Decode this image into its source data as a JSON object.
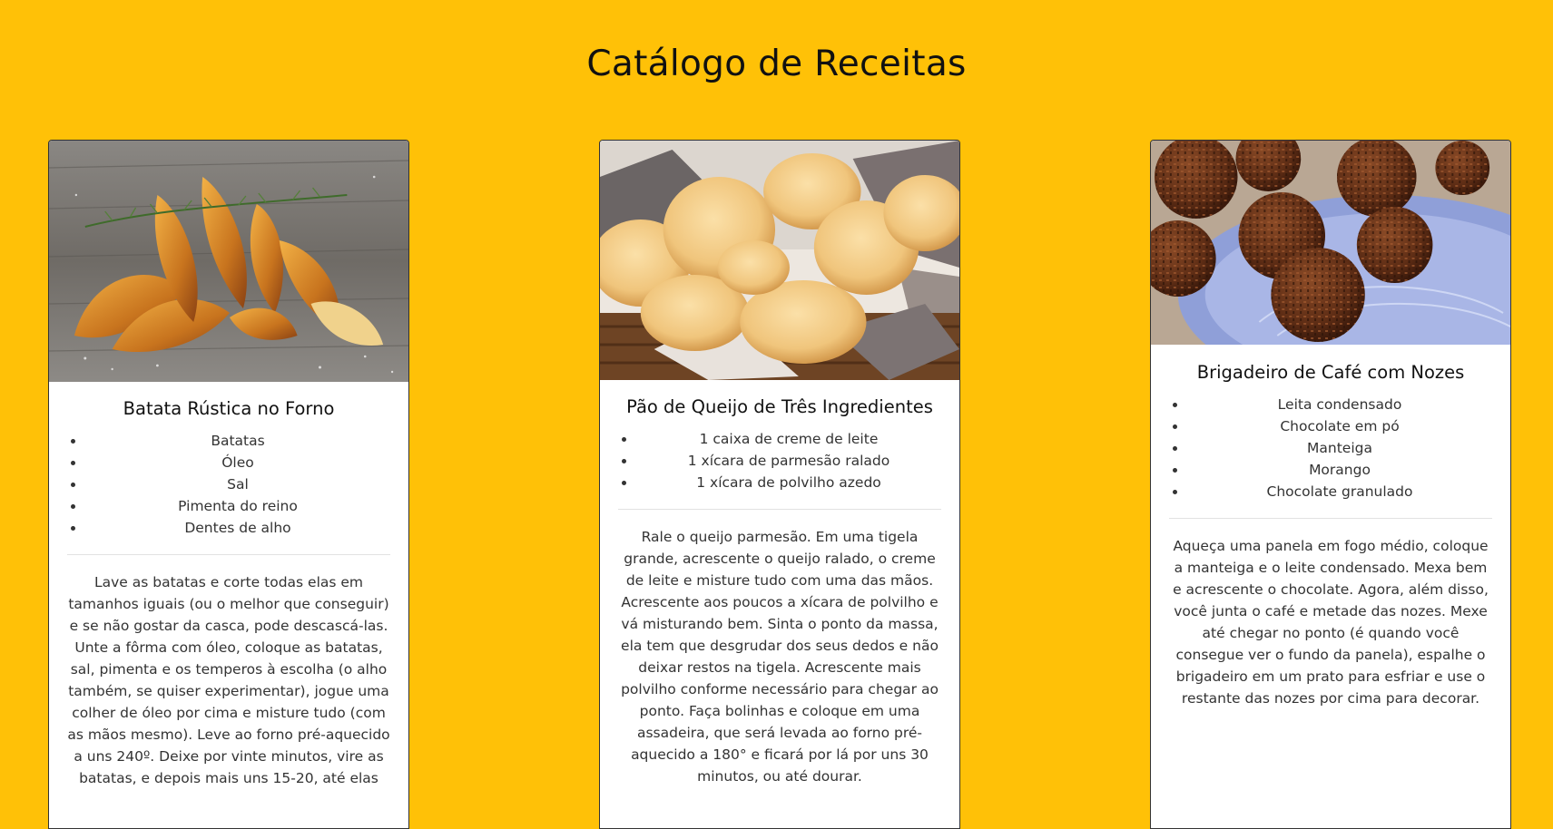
{
  "page": {
    "title": "Catálogo de Receitas",
    "background": "#FFC107"
  },
  "recipes": [
    {
      "image_icon": "potato-wedges-photo",
      "title": "Batata Rústica no Forno",
      "ingredients": [
        "Batatas",
        "Óleo",
        "Sal",
        "Pimenta do reino",
        "Dentes de alho"
      ],
      "instructions": "Lave as batatas e corte todas elas em tamanhos iguais (ou o melhor que conseguir) e se não gostar da casca, pode descascá-las. Unte a fôrma com óleo, coloque as batatas, sal, pimenta e os temperos à escolha (o alho também, se quiser experimentar), jogue uma colher de óleo por cima e misture tudo (com as mãos mesmo). Leve ao forno pré-aquecido a uns 240º. Deixe por vinte minutos, vire as batatas, e depois mais uns 15-20, até elas"
    },
    {
      "image_icon": "cheese-bread-photo",
      "title": "Pão de Queijo de Três Ingredientes",
      "ingredients": [
        "1 caixa de creme de leite",
        "1 xícara de parmesão ralado",
        "1 xícara de polvilho azedo"
      ],
      "instructions": "Rale o queijo parmesão. Em uma tigela grande, acrescente o queijo ralado, o creme de leite e misture tudo com uma das mãos. Acrescente aos poucos a xícara de polvilho e vá misturando bem. Sinta o ponto da massa, ela tem que desgrudar dos seus dedos e não deixar restos na tigela. Acrescente mais polvilho conforme necessário para chegar ao ponto. Faça bolinhas e coloque em uma assadeira, que será levada ao forno pré-aquecido a 180° e ficará por lá por uns 30 minutos, ou até dourar."
    },
    {
      "image_icon": "brigadeiro-photo",
      "title": "Brigadeiro de Café com Nozes",
      "ingredients": [
        "Leita condensado",
        "Chocolate em pó",
        "Manteiga",
        "Morango",
        "Chocolate granulado"
      ],
      "instructions": "Aqueça uma panela em fogo médio, coloque a manteiga e o leite condensado. Mexa bem e acrescente o chocolate. Agora, além disso, você junta o café e metade das nozes. Mexe até chegar no ponto (é quando você consegue ver o fundo da panela), espalhe o brigadeiro em um prato para esfriar e use o restante das nozes por cima para decorar."
    }
  ]
}
